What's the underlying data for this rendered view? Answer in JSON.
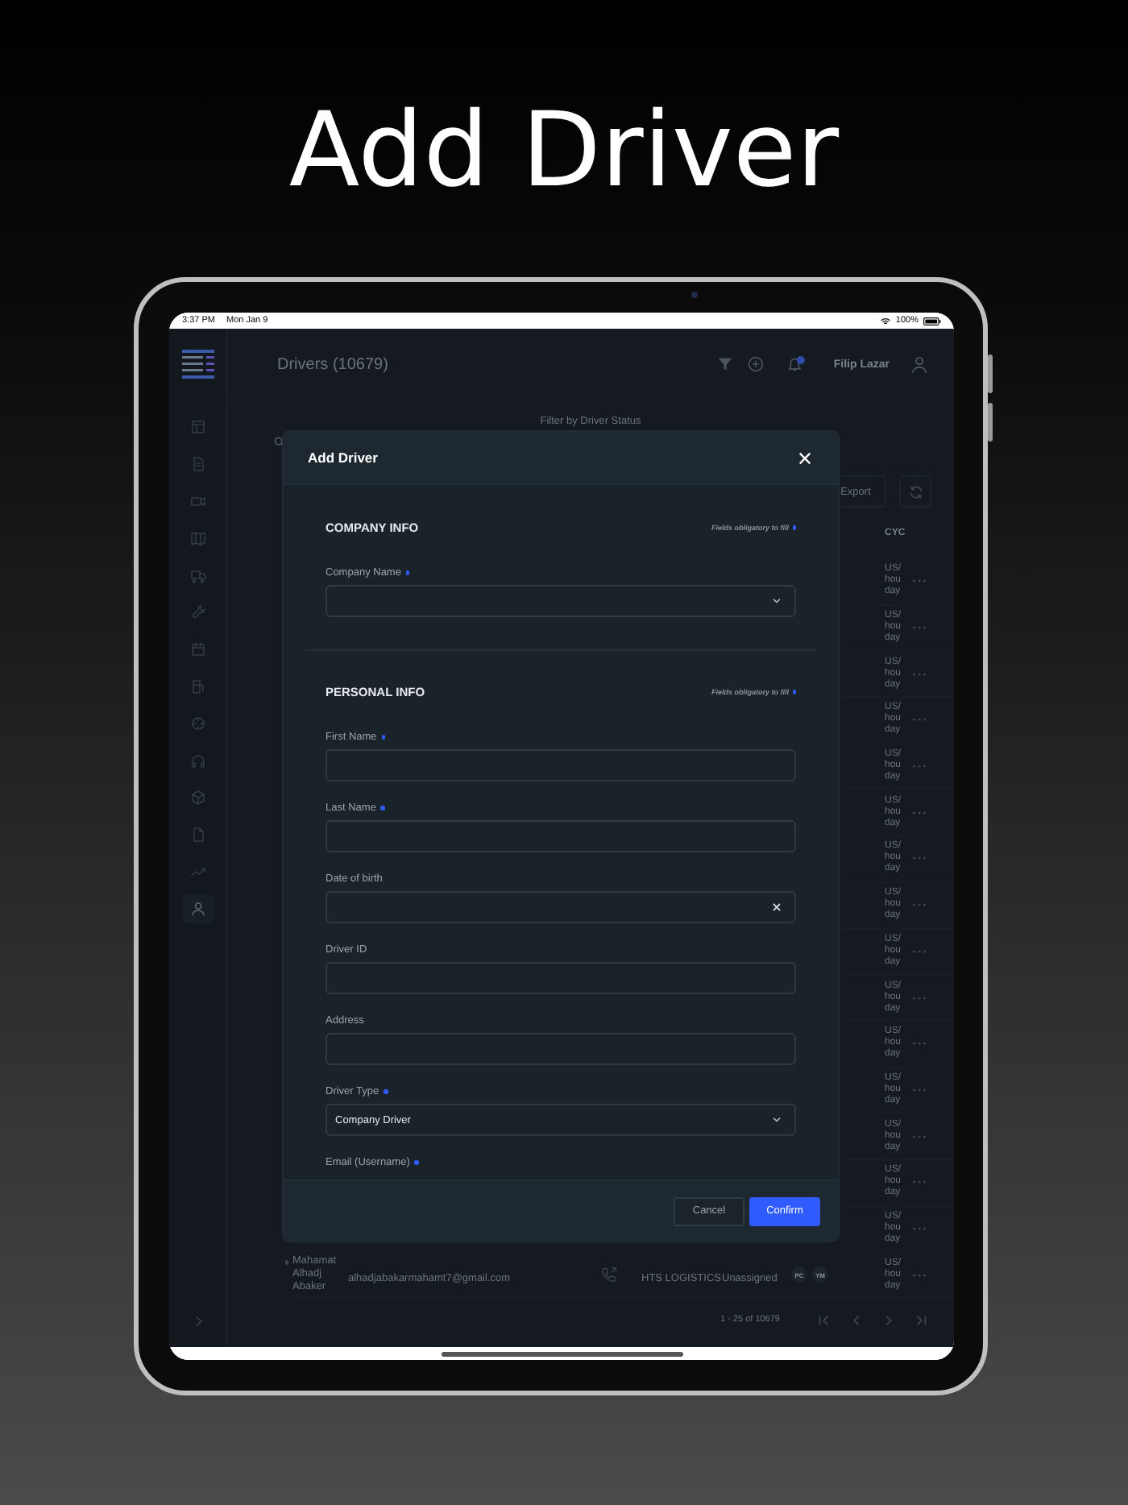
{
  "headline": "Add Driver",
  "status_bar": {
    "time": "3:37 PM",
    "date": "Mon Jan 9",
    "battery": "100%"
  },
  "sidebar": {
    "items": [
      {
        "kind": "layout",
        "selected": false
      },
      {
        "kind": "document",
        "selected": false
      },
      {
        "kind": "video",
        "selected": false
      },
      {
        "kind": "map",
        "selected": false
      },
      {
        "kind": "truck",
        "selected": false
      },
      {
        "kind": "wrench",
        "selected": false
      },
      {
        "kind": "calendar",
        "selected": false
      },
      {
        "kind": "fuel",
        "selected": false
      },
      {
        "kind": "target",
        "selected": false
      },
      {
        "kind": "headphones",
        "selected": false
      },
      {
        "kind": "cube",
        "selected": false
      },
      {
        "kind": "file",
        "selected": false
      },
      {
        "kind": "trend",
        "selected": false
      },
      {
        "kind": "user",
        "selected": true
      }
    ]
  },
  "header": {
    "title": "Drivers (10679)",
    "user_name": "Filip Lazar"
  },
  "filter": {
    "label": "Filter by Driver Status"
  },
  "toolbar": {
    "export": "Export"
  },
  "table": {
    "columns": [
      {
        "label": "CYC"
      }
    ],
    "rows": [
      {
        "cycle": "US/ hou day"
      },
      {
        "cycle": "US/ hou day"
      },
      {
        "cycle": "US/ hou day"
      },
      {
        "cycle": "US/ hou day"
      },
      {
        "cycle": "US/ hou day"
      },
      {
        "cycle": "US/ hou day"
      },
      {
        "cycle": "US/ hou day"
      },
      {
        "cycle": "US/ hou day"
      },
      {
        "cycle": "US/ hou day"
      },
      {
        "cycle": "US/ hou day"
      },
      {
        "cycle": "US/ hou day"
      },
      {
        "cycle": "US/ hou day"
      },
      {
        "cycle": "US/ hou day"
      },
      {
        "cycle": "US/ hou day"
      },
      {
        "cycle": "US/ hou day"
      },
      {
        "name": "Mahamat Alhadj Abaker",
        "email": "alhadjabakarmahamt7@gmail.com",
        "company": "HTS LOGISTICS",
        "status": "Unassigned",
        "badges": [
          "PC",
          "YM"
        ],
        "cycle": "US/ hou day"
      }
    ]
  },
  "pagination": {
    "range": "1 - 25 of 10679"
  },
  "modal": {
    "title": "Add Driver",
    "sections": [
      {
        "title": "COMPANY INFO",
        "note": "Fields obligatory to fill",
        "fields": [
          {
            "label": "Company Name",
            "required": true,
            "kind": "select"
          }
        ]
      },
      {
        "title": "PERSONAL INFO",
        "note": "Fields obligatory to fill",
        "fields": [
          {
            "label": "First Name",
            "required": true,
            "kind": "text"
          },
          {
            "label": "Last Name",
            "required": true,
            "kind": "text"
          },
          {
            "label": "Date of birth",
            "required": false,
            "kind": "date"
          },
          {
            "label": "Driver ID",
            "required": false,
            "kind": "text"
          },
          {
            "label": "Address",
            "required": false,
            "kind": "text"
          },
          {
            "label": "Driver Type",
            "required": true,
            "kind": "select",
            "value": "Company Driver"
          },
          {
            "label": "Email (Username)",
            "required": true,
            "kind": "cut"
          }
        ]
      }
    ],
    "buttons": [
      {
        "label": "Cancel",
        "kind": "secondary"
      },
      {
        "label": "Confirm",
        "kind": "primary"
      }
    ]
  }
}
